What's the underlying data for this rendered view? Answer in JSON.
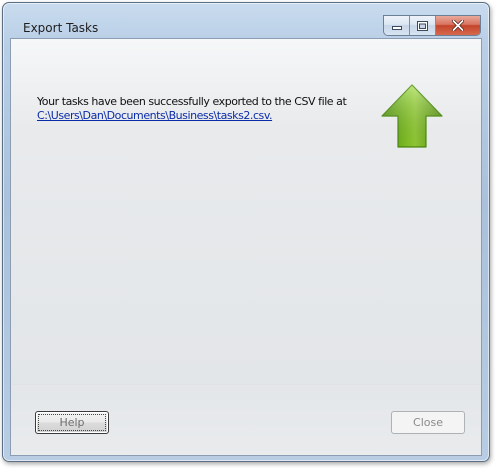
{
  "window": {
    "title": "Export Tasks"
  },
  "caption_buttons": {
    "minimize_icon": "minimize-icon",
    "maximize_icon": "maximize-icon",
    "close_icon": "close-x-icon",
    "close_color": "#c4442b"
  },
  "content": {
    "message": "Your tasks have been successfully exported to the CSV file at",
    "file_path": "C:\\Users\\Dan\\Documents\\Business\\tasks2.csv."
  },
  "icon": {
    "name": "up-arrow-icon",
    "color": "#7cc41c"
  },
  "footer": {
    "help_label": "Help",
    "close_label": "Close"
  }
}
